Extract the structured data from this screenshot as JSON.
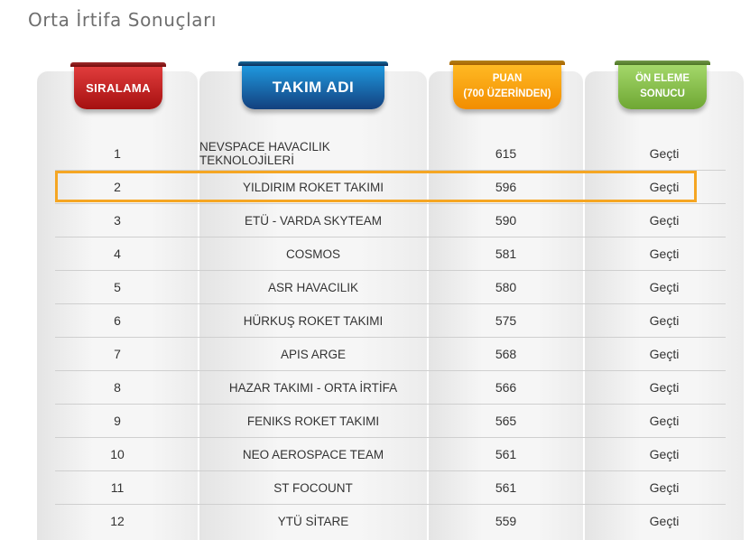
{
  "page": {
    "title": "Orta İrtifa Sonuçları"
  },
  "headers": {
    "rank": "SIRALAMA",
    "team": "TAKIM ADI",
    "score_line1": "PUAN",
    "score_line2": "(700 ÜZERİNDEN)",
    "result_line1": "ÖN ELEME",
    "result_line2": "SONUCU"
  },
  "colors": {
    "rank_badge": "#c81f1f",
    "team_badge": "#1a6fb5",
    "score_badge": "#f9a312",
    "result_badge": "#8cc24f",
    "highlight_border": "#f5a623"
  },
  "highlighted_row_index": 1,
  "rows": [
    {
      "rank": "1",
      "team": "NEVSPACE HAVACILIK TEKNOLOJİLERİ",
      "score": "615",
      "result": "Geçti"
    },
    {
      "rank": "2",
      "team": "YILDIRIM ROKET TAKIMI",
      "score": "596",
      "result": "Geçti"
    },
    {
      "rank": "3",
      "team": "ETÜ - VARDA SKYTEAM",
      "score": "590",
      "result": "Geçti"
    },
    {
      "rank": "4",
      "team": "COSMOS",
      "score": "581",
      "result": "Geçti"
    },
    {
      "rank": "5",
      "team": "ASR HAVACILIK",
      "score": "580",
      "result": "Geçti"
    },
    {
      "rank": "6",
      "team": "HÜRKUŞ ROKET TAKIMI",
      "score": "575",
      "result": "Geçti"
    },
    {
      "rank": "7",
      "team": "APIS ARGE",
      "score": "568",
      "result": "Geçti"
    },
    {
      "rank": "8",
      "team": "HAZAR TAKIMI - ORTA İRTİFA",
      "score": "566",
      "result": "Geçti"
    },
    {
      "rank": "9",
      "team": "FENIKS ROKET TAKIMI",
      "score": "565",
      "result": "Geçti"
    },
    {
      "rank": "10",
      "team": "NEO AEROSPACE TEAM",
      "score": "561",
      "result": "Geçti"
    },
    {
      "rank": "11",
      "team": "ST FOCOUNT",
      "score": "561",
      "result": "Geçti"
    },
    {
      "rank": "12",
      "team": "YTÜ SİTARE",
      "score": "559",
      "result": "Geçti"
    }
  ]
}
